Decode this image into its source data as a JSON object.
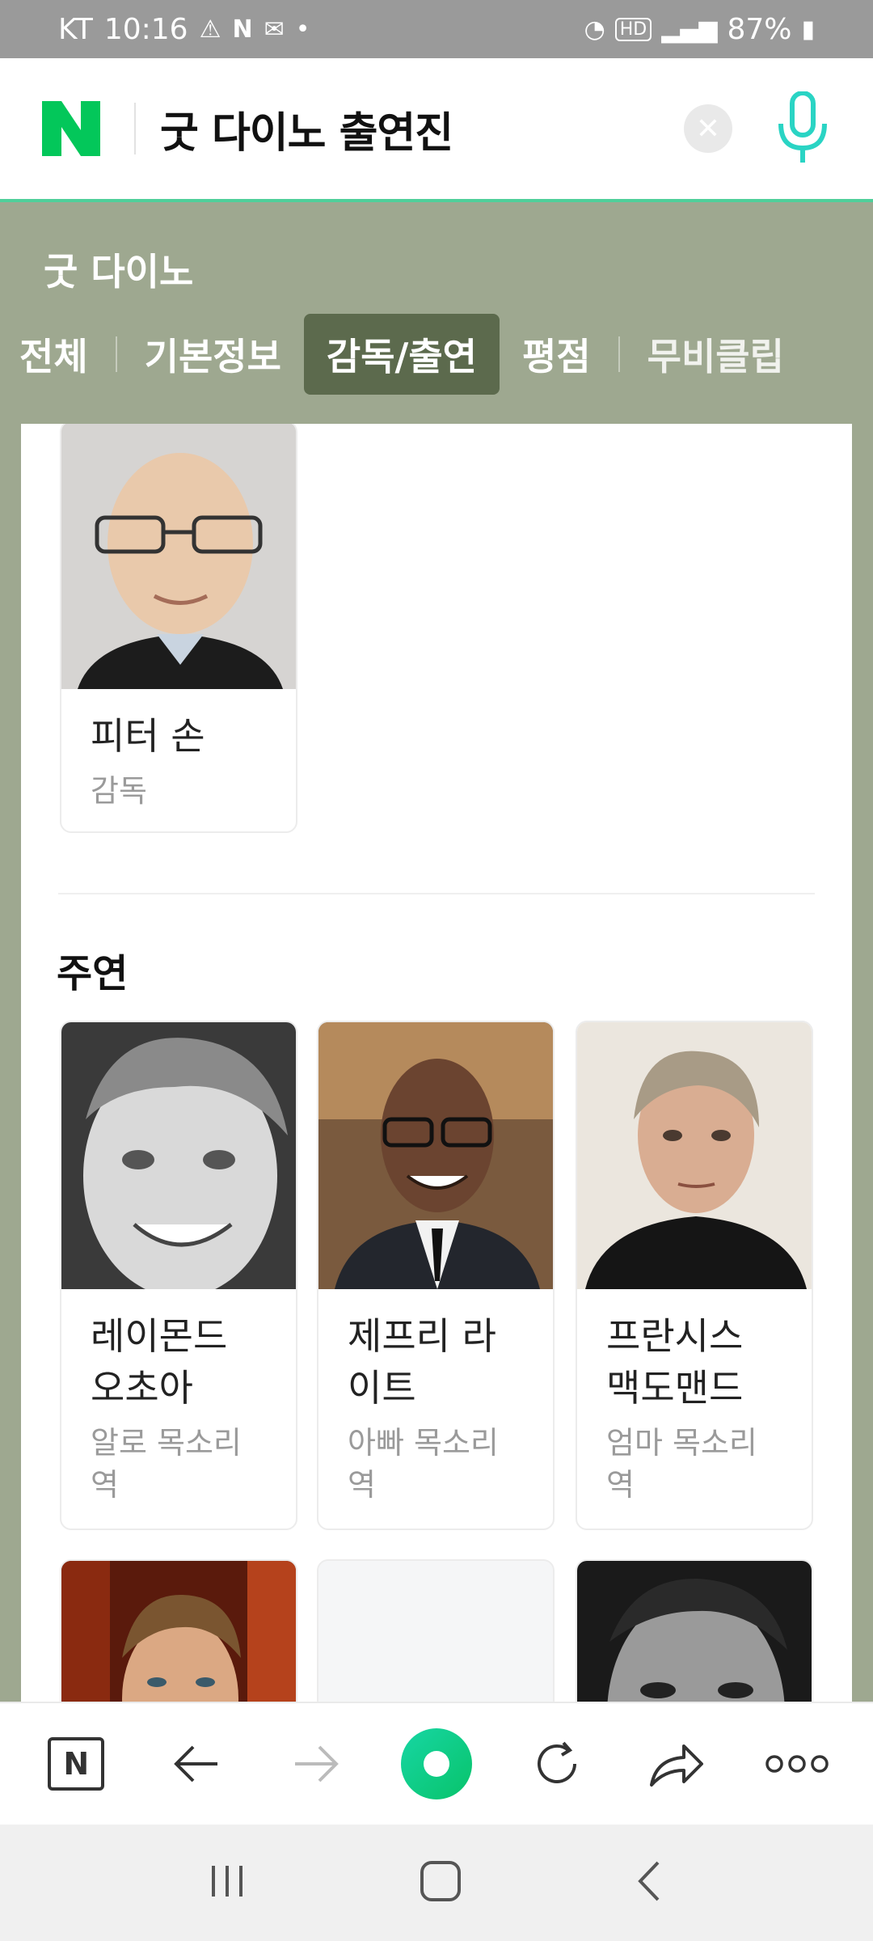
{
  "status_bar": {
    "carrier": "KT",
    "time": "10:16",
    "battery": "87%"
  },
  "search": {
    "query": "굿 다이노 출연진",
    "logo_letter": "N"
  },
  "movie": {
    "title": "굿 다이노"
  },
  "tabs": [
    {
      "label": "전체",
      "active": false
    },
    {
      "label": "기본정보",
      "active": false
    },
    {
      "label": "감독/출연",
      "active": true
    },
    {
      "label": "평점",
      "active": false
    },
    {
      "label": "무비클립",
      "active": false
    }
  ],
  "director": {
    "name": "피터 손",
    "role": "감독"
  },
  "cast_section": {
    "title": "주연"
  },
  "cast": [
    {
      "name": "레이몬드\n오초아",
      "role": "알로 목소리\n역"
    },
    {
      "name": "제프리 라\n이트",
      "role": "아빠 목소리\n역"
    },
    {
      "name": "프란시스\n맥도맨드",
      "role": "엄마 목소리\n역"
    }
  ],
  "placeholder_logo": "N",
  "toolbar": {
    "home_letter": "N"
  },
  "colors": {
    "naver_green": "#03c75a",
    "header_bg": "#9ea890",
    "active_tab": "#5c6a4d",
    "mic": "#2ad4c4"
  }
}
